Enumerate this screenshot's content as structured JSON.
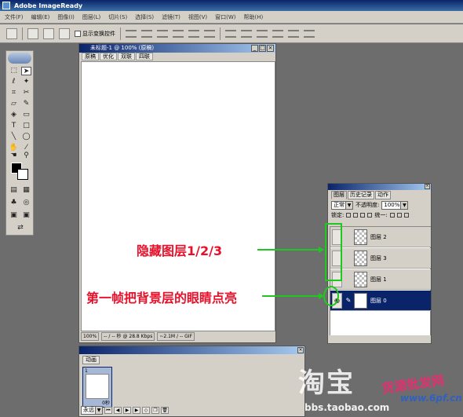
{
  "app": {
    "title": "Adobe ImageReady"
  },
  "menu": [
    "文件(F)",
    "编辑(E)",
    "图像(I)",
    "图层(L)",
    "切片(S)",
    "选择(S)",
    "滤镜(T)",
    "视图(V)",
    "窗口(W)",
    "帮助(H)"
  ],
  "options_bar": {
    "show_transform_label": "显示变换控件"
  },
  "document": {
    "title": "未标题-1 @ 100% (原稿)",
    "tabs": [
      "原稿",
      "优化",
      "双联",
      "四联"
    ],
    "status": {
      "zoom": "100%",
      "time": "-- / -- 秒 @ 28.8 Kbps",
      "size": "~2.1M / -- GIF"
    }
  },
  "layers_panel": {
    "tabs": [
      "图层",
      "历史记录",
      "动作"
    ],
    "blend_mode": "正常",
    "opacity_label": "不透明度:",
    "opacity_value": "100%",
    "lock_label": "锁定:",
    "unify_label": "统一:",
    "layers": [
      {
        "name": "图层 2",
        "visible": false,
        "thumb": "transparent"
      },
      {
        "name": "图层 3",
        "visible": false,
        "thumb": "transparent"
      },
      {
        "name": "图层 1",
        "visible": false,
        "thumb": "transparent"
      },
      {
        "name": "图层 0",
        "visible": true,
        "thumb": "white",
        "selected": true
      }
    ]
  },
  "annotations": {
    "hide_layers": "隐藏图层1/2/3",
    "show_background": "第一帧把背景层的眼睛点亮"
  },
  "animation_panel": {
    "tab": "动画",
    "frame_number": "1",
    "frame_delay": "0秒",
    "loop": "永远"
  },
  "watermark": {
    "main": "淘宝",
    "url": "bbs.taobao.com",
    "site_cn": "货源批发网",
    "site_url": "www.6pf.cn"
  },
  "colors": {
    "annotation_red": "#e8102a",
    "annotation_green": "#1fc81f",
    "selection_blue": "#0a246a"
  }
}
